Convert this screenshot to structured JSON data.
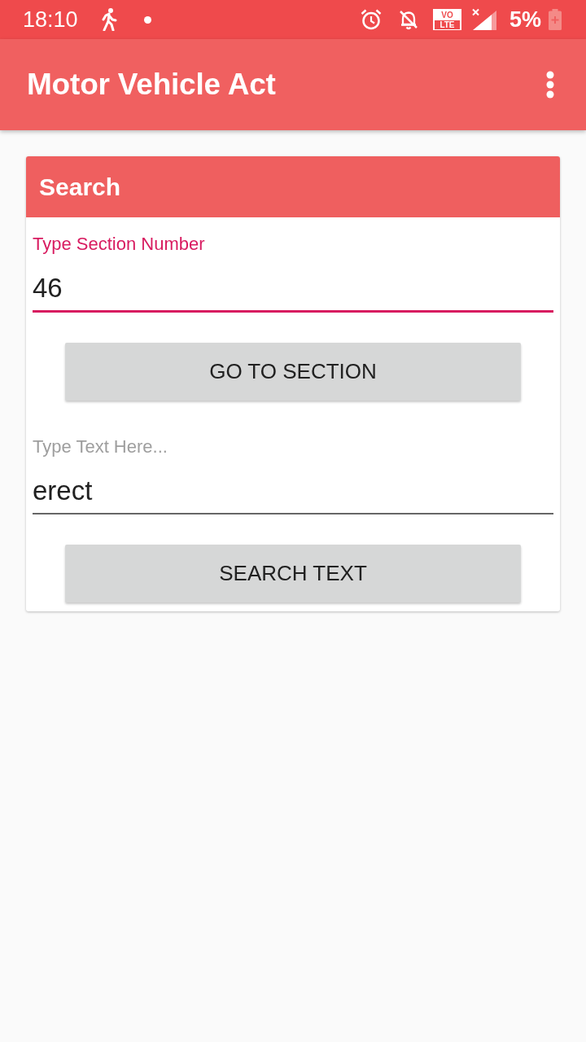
{
  "status_bar": {
    "time": "18:10",
    "network_badge": {
      "top": "VO",
      "bottom": "LTE"
    },
    "battery": "5%"
  },
  "app_bar": {
    "title": "Motor Vehicle Act"
  },
  "card": {
    "title": "Search",
    "items": [
      {
        "kind": "field",
        "label": "Type Section Number",
        "value": "46",
        "focused": true
      },
      {
        "kind": "button",
        "label": "GO TO SECTION"
      },
      {
        "kind": "field",
        "label": "Type Text Here...",
        "value": "erect",
        "focused": false
      },
      {
        "kind": "button",
        "label": "SEARCH TEXT"
      }
    ]
  }
}
